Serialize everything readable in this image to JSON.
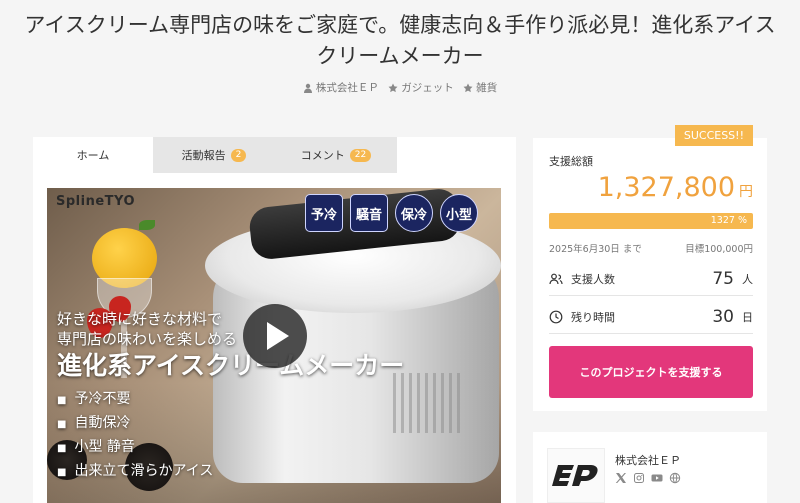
{
  "title": {
    "line1": "アイスクリーム専門店の味をご家庭で。健康志向＆手作り派必見！進化系アイス",
    "line2": "クリームメーカー"
  },
  "meta": {
    "owner": "株式会社ＥＰ",
    "category1": "ガジェット",
    "category2": "雑貨"
  },
  "tabs": [
    {
      "label": "ホーム"
    },
    {
      "label": "活動報告",
      "count": "2"
    },
    {
      "label": "コメント",
      "count": "22"
    }
  ],
  "media": {
    "brand": "SplineTYO",
    "icons": [
      "予冷",
      "騒音",
      "保冷",
      "小型"
    ],
    "tagline1": "好きな時に好きな材料で",
    "tagline2": "専門店の味わいを楽しめる",
    "tagline3": "進化系アイスクリームメーカー",
    "bullets": [
      "予冷不要",
      "自動保冷",
      "小型 静音",
      "出来立て滑らかアイス"
    ]
  },
  "status": {
    "success_label": "SUCCESS!!"
  },
  "funding": {
    "total_label": "支援総額",
    "total": "1,327,800",
    "currency": "円",
    "percent_label": "1327 %",
    "percent": 1327,
    "deadline": "2025年6月30日 まで",
    "goal": "目標100,000円",
    "supporters_label": "支援人数",
    "supporters": "75",
    "supporters_unit": "人",
    "remaining_label": "残り時間",
    "remaining": "30",
    "remaining_unit": "日",
    "cta_label": "このプロジェクトを支援する"
  },
  "owner": {
    "name": "株式会社ＥＰ"
  },
  "colors": {
    "accent": "#f6b84f",
    "cta": "#e3377b",
    "amount": "#f0a23e"
  }
}
